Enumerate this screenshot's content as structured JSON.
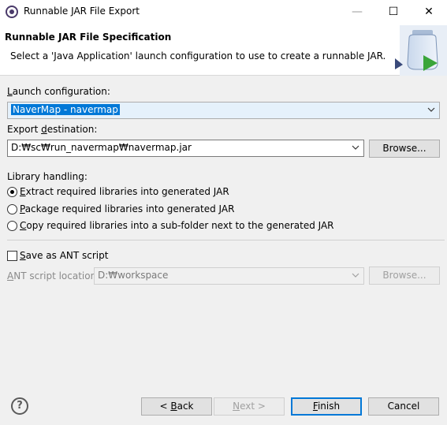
{
  "window": {
    "title": "Runnable JAR File Export",
    "minimize_glyph": "—",
    "maximize_glyph": "☐",
    "close_glyph": "✕"
  },
  "header": {
    "title": "Runnable JAR File Specification",
    "description": "Select a 'Java Application' launch configuration to use to create a runnable JAR."
  },
  "launch": {
    "label_pre": "",
    "label_mn": "L",
    "label_post": "aunch configuration:",
    "value": "NaverMap - navermap"
  },
  "export": {
    "label_pre": "Export ",
    "label_mn": "d",
    "label_post": "estination:",
    "value": "D:₩sc₩run_navermap₩navermap.jar",
    "browse_label": "Browse..."
  },
  "library": {
    "label": "Library handling:",
    "options": [
      {
        "pre": "",
        "mn": "E",
        "post": "xtract required libraries into generated JAR",
        "checked": true
      },
      {
        "pre": "",
        "mn": "P",
        "post": "ackage required libraries into generated JAR",
        "checked": false
      },
      {
        "pre": "",
        "mn": "C",
        "post": "opy required libraries into a sub-folder next to the generated JAR",
        "checked": false
      }
    ]
  },
  "ant": {
    "save_pre": "",
    "save_mn": "S",
    "save_post": "ave as ANT script",
    "save_checked": false,
    "loc_pre": "",
    "loc_mn": "A",
    "loc_post": "NT script location:",
    "loc_value": "D:₩workspace",
    "browse_label": "Browse..."
  },
  "footer": {
    "help_glyph": "?",
    "back_pre": "< ",
    "back_mn": "B",
    "back_post": "ack",
    "next_pre": "",
    "next_mn": "N",
    "next_post": "ext >",
    "finish_pre": "",
    "finish_mn": "F",
    "finish_post": "inish",
    "cancel_label": "Cancel"
  },
  "colors": {
    "accent": "#0078d7",
    "dialog_bg": "#f0f0f0"
  }
}
